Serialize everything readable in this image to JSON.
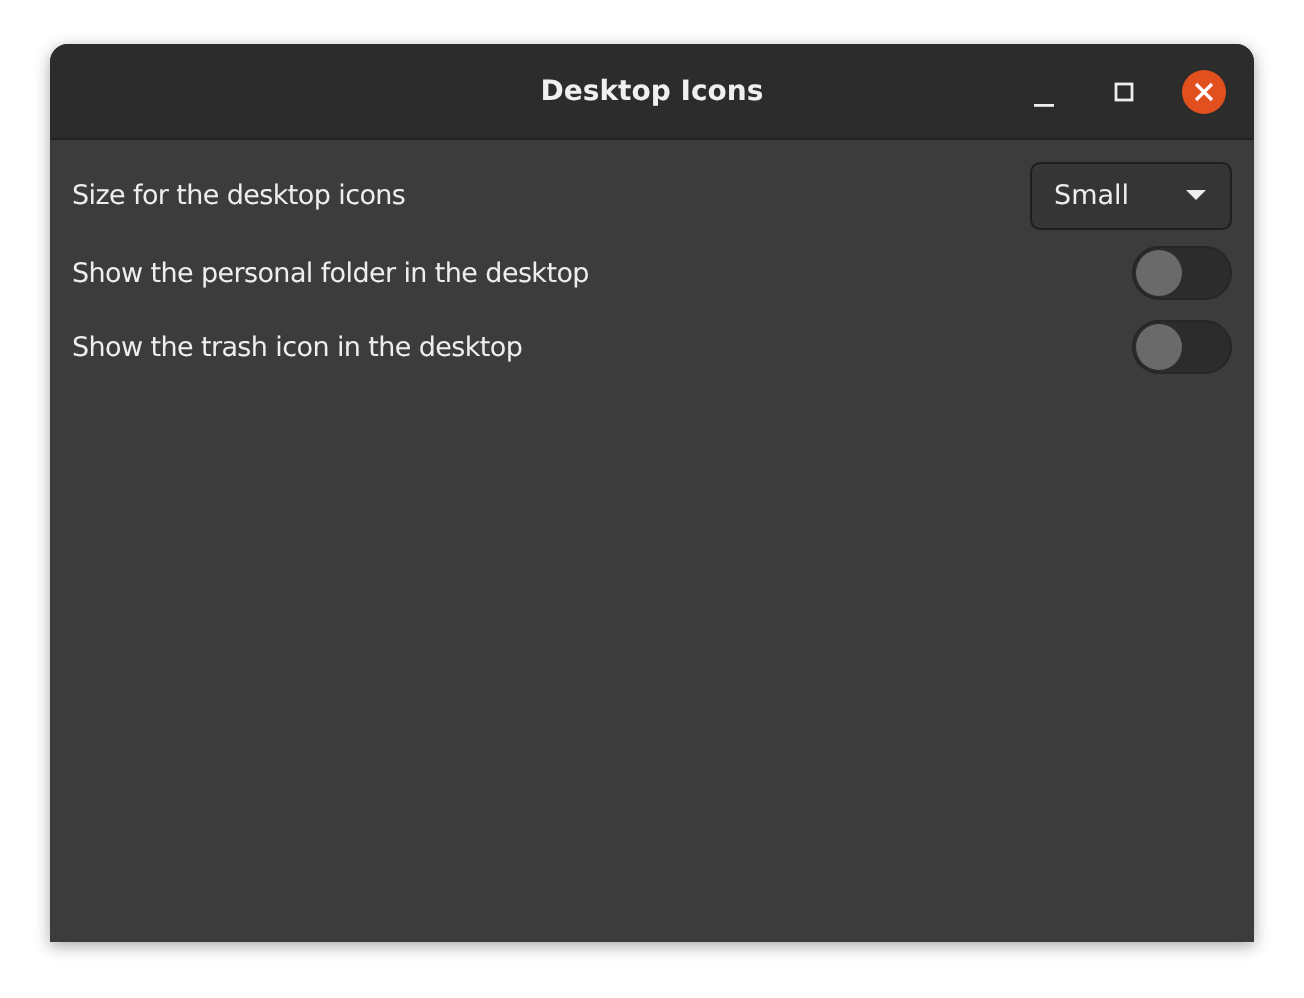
{
  "window": {
    "title": "Desktop Icons"
  },
  "settings": [
    {
      "kind": "dropdown",
      "label": "Size for the desktop icons",
      "value": "Small"
    },
    {
      "kind": "switch",
      "label": "Show the personal folder in the desktop",
      "on": false
    },
    {
      "kind": "switch",
      "label": "Show the trash icon in the desktop",
      "on": false
    }
  ]
}
